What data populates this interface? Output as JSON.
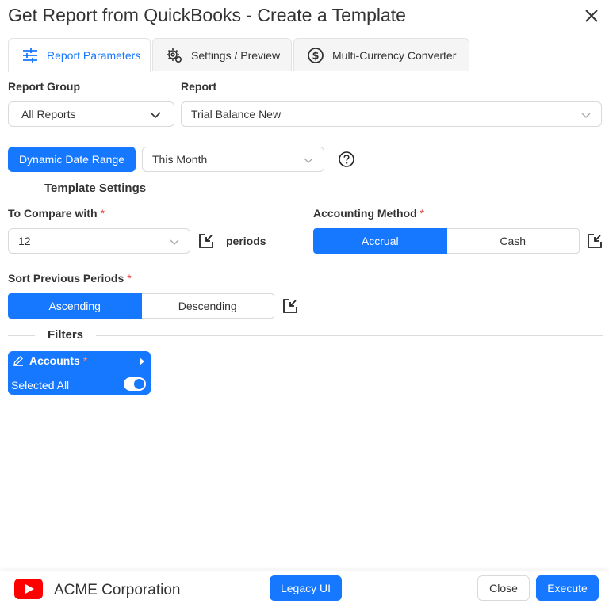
{
  "dialog": {
    "title": "Get Report from QuickBooks - Create a Template"
  },
  "tabs": [
    {
      "label": "Report Parameters",
      "icon": "sliders-icon",
      "active": true
    },
    {
      "label": "Settings / Preview",
      "icon": "gears-icon",
      "active": false
    },
    {
      "label": "Multi-Currency Converter",
      "icon": "dollar-icon",
      "active": false
    }
  ],
  "report_group": {
    "label": "Report Group",
    "value": "All Reports"
  },
  "report": {
    "label": "Report",
    "value": "Trial Balance New"
  },
  "date_range": {
    "button_label": "Dynamic Date Range",
    "value": "This Month"
  },
  "template_settings": {
    "section_title": "Template Settings"
  },
  "compare": {
    "label": "To Compare with",
    "required_mark": "*",
    "value": "12",
    "suffix": "periods"
  },
  "accounting_method": {
    "label": "Accounting Method",
    "required_mark": "*",
    "options": [
      "Accrual",
      "Cash"
    ],
    "selected": "Accrual"
  },
  "sort": {
    "label": "Sort Previous Periods",
    "required_mark": "*",
    "options": [
      "Ascending",
      "Descending"
    ],
    "selected": "Ascending"
  },
  "filters": {
    "section_title": "Filters",
    "accounts": {
      "label": "Accounts",
      "required_mark": "*",
      "status": "Selected All",
      "toggle_on": true
    }
  },
  "footer": {
    "company": "ACME Corporation",
    "legacy_label": "Legacy UI",
    "close_label": "Close",
    "execute_label": "Execute"
  },
  "colors": {
    "accent": "#1677ff",
    "required": "#e53935",
    "youtube": "#ff0000"
  }
}
